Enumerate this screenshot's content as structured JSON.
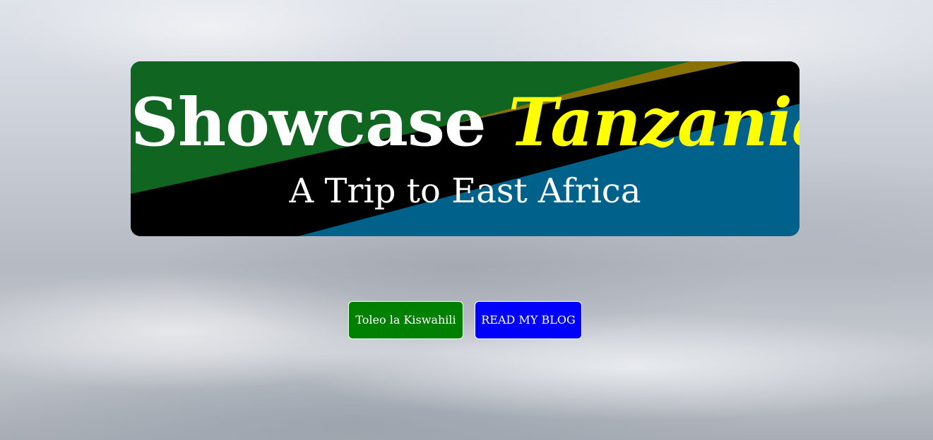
{
  "banner": {
    "title_main": "Showcase",
    "title_accent": "Tanzania",
    "subtitle": "A Trip to East Africa"
  },
  "flag_colors": {
    "green": "#106620",
    "gold": "#8a7200",
    "black": "#000000",
    "blue": "#00628a"
  },
  "buttons": {
    "swahili_label": "Toleo la Kiswahili",
    "blog_label": "READ MY BLOG"
  },
  "button_colors": {
    "swahili": "#008000",
    "blog": "#0000ff"
  }
}
